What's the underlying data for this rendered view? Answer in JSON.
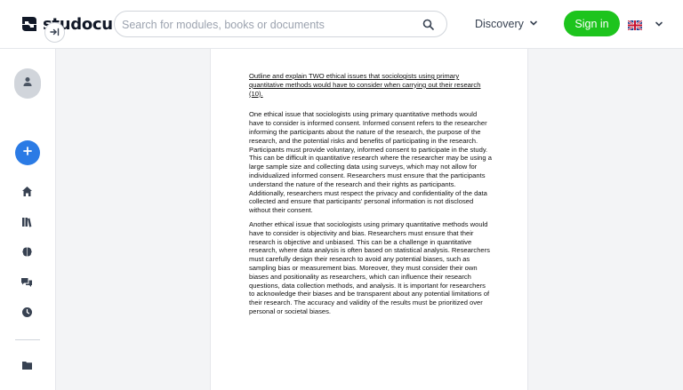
{
  "brand": {
    "name": "studocu"
  },
  "search": {
    "placeholder": "Search for modules, books or documents"
  },
  "nav": {
    "discovery_label": "Discovery",
    "signin_label": "Sign in"
  },
  "icons": {
    "logo": "studocu-logo-icon",
    "search": "search-icon",
    "chevron": "chevron-down-icon",
    "flag": "uk-flag-icon",
    "avatar": "user-icon",
    "expand": "expand-sidebar-icon",
    "add": "plus-icon",
    "home": "home-icon",
    "library": "library-icon",
    "ai": "brain-icon",
    "chat": "chat-icon",
    "recent": "clock-icon",
    "folder": "folder-icon"
  },
  "colors": {
    "accent_green": "#1dc41d",
    "accent_blue": "#2b7be5"
  },
  "document": {
    "question": "Outline and explain TWO ethical issues that sociologists using primary quantitative methods would have to consider when carrying out their research (10).",
    "paragraphs": [
      "One ethical issue that sociologists using primary quantitative methods would have to consider is informed consent. Informed consent refers to the researcher informing the participants about the nature of the research, the purpose of the research, and the potential risks and benefits of participating in the research. Participants must provide voluntary, informed consent to participate in the study. This can be difficult in quantitative research where the researcher may be using a large sample size and collecting data using surveys, which may not allow for individualized informed consent. Researchers must ensure that the participants understand the nature of the research and their rights as participants. Additionally, researchers must respect the privacy and confidentiality of the data collected and ensure that participants' personal information is not disclosed without their consent.",
      "Another ethical issue that sociologists using primary quantitative methods would have to consider is objectivity and bias. Researchers must ensure that their research is objective and unbiased. This can be a challenge in quantitative research, where data analysis is often based on statistical analysis. Researchers must carefully design their research to avoid any potential biases, such as sampling bias or measurement bias. Moreover, they must consider their own biases and positionality as researchers, which can influence their research questions, data collection methods, and analysis. It is important for researchers to acknowledge their biases and be transparent about any potential limitations of their research. The accuracy and validity of the results must be prioritized over personal or societal biases."
    ]
  }
}
